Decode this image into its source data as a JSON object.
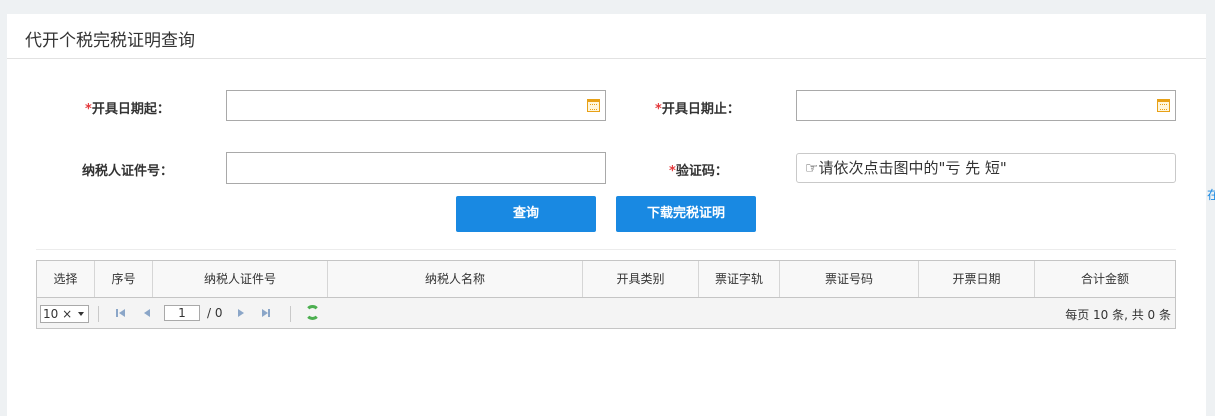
{
  "page": {
    "title": "代开个税完税证明查询",
    "edge_text": "在"
  },
  "form": {
    "start_date_label": "开具日期起：",
    "end_date_label": "开具日期止：",
    "taxpayer_id_label": "纳税人证件号：",
    "captcha_label": "验证码：",
    "required_mark": "*",
    "start_date_value": "",
    "end_date_value": "",
    "taxpayer_id_value": "",
    "captcha_hint": "☞请依次点击图中的\"亏 先 短\""
  },
  "buttons": {
    "query": "查询",
    "download": "下载完税证明"
  },
  "table": {
    "columns": [
      "选择",
      "序号",
      "纳税人证件号",
      "纳税人名称",
      "开具类别",
      "票证字轨",
      "票证号码",
      "开票日期",
      "合计金额"
    ],
    "rows": []
  },
  "pager": {
    "page_size": "10 ×",
    "current_page": "1",
    "total_pages": "/ 0",
    "info": "每页 10 条, 共 0 条"
  },
  "colors": {
    "accent": "#1989e2",
    "required": "#e4393c"
  }
}
